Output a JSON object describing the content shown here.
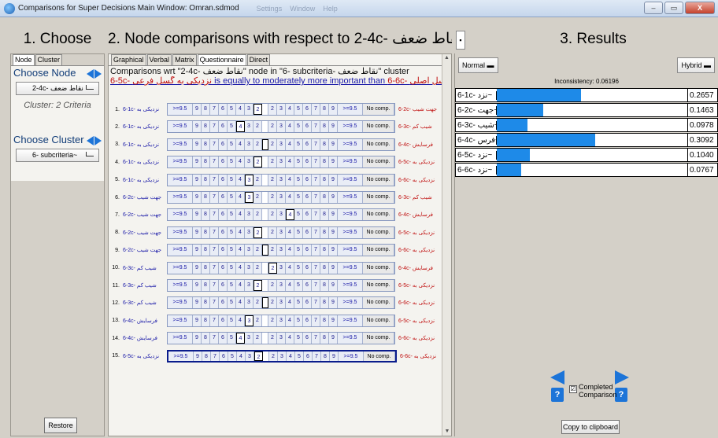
{
  "window": {
    "title": "Comparisons for Super Decisions Main Window: Omran.sdmod",
    "ghost_menu": [
      "Settings",
      "Window",
      "Help"
    ],
    "btn_min": "–",
    "btn_max": "▭",
    "btn_close": "X"
  },
  "headers": {
    "choose": "1. Choose",
    "comparisons": "2. Node comparisons with respect to 2-4c- نقاط ضعف",
    "results": "3. Results"
  },
  "choose": {
    "tabs": [
      "Node",
      "Cluster"
    ],
    "choose_node_label": "Choose Node",
    "node_value": "2-4c- نقاط ضعف",
    "cluster_info": "Cluster: 2 Criteria",
    "choose_cluster_label": "Choose Cluster",
    "cluster_value": "6- subcriteria~",
    "restore": "Restore"
  },
  "comparisons": {
    "tabs": [
      "Graphical",
      "Verbal",
      "Matrix",
      "Questionnaire",
      "Direct"
    ],
    "active_tab": "Questionnaire",
    "header_line1": "Comparisons wrt \"2-4c- نقاط ضعف\" node in \"6- subcriteria- نقاط ضعف\" cluster",
    "header_line2_left": "6-5c- نزدیکی به گسل فرعی",
    "header_line2_mid": " is equally to moderately more important than ",
    "header_line2_right": "6-6c- نزدیکی به گسل اصلی",
    "scale_left": [
      ">=9.5",
      "9",
      "8",
      "7",
      "6",
      "5",
      "4",
      "3",
      "2"
    ],
    "scale_right": [
      "2",
      "3",
      "4",
      "5",
      "6",
      "7",
      "8",
      "9",
      ">=9.5"
    ],
    "no_comp": "No comp.",
    "rows": [
      {
        "n": "1.",
        "left": "6-1c- نزدیکی به",
        "right": "6-2c- جهت شیب",
        "sel": "L2"
      },
      {
        "n": "2.",
        "left": "6-1c- نزدیکی به",
        "right": "6-3c- شیب کم",
        "sel": "L4"
      },
      {
        "n": "3.",
        "left": "6-1c- نزدیکی به",
        "right": "6-4c- فرسایش",
        "sel": "1"
      },
      {
        "n": "4.",
        "left": "6-1c- نزدیکی به",
        "right": "6-5c- نزدیکی به",
        "sel": "L2"
      },
      {
        "n": "5.",
        "left": "6-1c- نزدیکی به",
        "right": "6-6c- نزدیکی به",
        "sel": "L3"
      },
      {
        "n": "6.",
        "left": "6-2c- جهت شیب",
        "right": "6-3c- شیب کم",
        "sel": "L3"
      },
      {
        "n": "7.",
        "left": "6-2c- جهت شیب",
        "right": "6-4c- فرسایش",
        "sel": "R4"
      },
      {
        "n": "8.",
        "left": "6-2c- جهت شیب",
        "right": "6-5c- نزدیکی به",
        "sel": "L2"
      },
      {
        "n": "9.",
        "left": "6-2c- جهت شیب",
        "right": "6-6c- نزدیکی به",
        "sel": "1"
      },
      {
        "n": "10.",
        "left": "6-3c- شیب کم",
        "right": "6-4c- فرسایش",
        "sel": "R2"
      },
      {
        "n": "11.",
        "left": "6-3c- شیب کم",
        "right": "6-5c- نزدیکی به",
        "sel": "L2"
      },
      {
        "n": "12.",
        "left": "6-3c- شیب کم",
        "right": "6-6c- نزدیکی به",
        "sel": "1"
      },
      {
        "n": "13.",
        "left": "6-4c- فرسایش",
        "right": "6-5c- نزدیکی به",
        "sel": "L3"
      },
      {
        "n": "14.",
        "left": "6-4c- فرسایش",
        "right": "6-6c- نزدیکی به",
        "sel": "L4"
      },
      {
        "n": "15.",
        "left": "6-5c- نزدیکی به",
        "right": "6-6c- نزدیکی به",
        "sel": "L2"
      }
    ]
  },
  "results": {
    "normal_btn": "Normal",
    "hybrid_btn": "Hybrid",
    "inconsistency": "Inconsistency: 0.06196",
    "rows": [
      {
        "label": "6-1c- نزد~",
        "value": "0.2657",
        "v": 0.2657
      },
      {
        "label": "6-2c- جهت~",
        "value": "0.1463",
        "v": 0.1463
      },
      {
        "label": "6-3c- شیب~",
        "value": "0.0978",
        "v": 0.0978
      },
      {
        "label": "6-4c- فرس~",
        "value": "0.3092",
        "v": 0.3092
      },
      {
        "label": "6-5c- نزد~",
        "value": "0.1040",
        "v": 0.104
      },
      {
        "label": "6-6c- نزد~",
        "value": "0.0767",
        "v": 0.0767
      }
    ],
    "completed_label": "Completed Comparison",
    "completed_checked": "☑",
    "copy_button": "Copy to clipboard",
    "accent": "#1e8ae8"
  }
}
